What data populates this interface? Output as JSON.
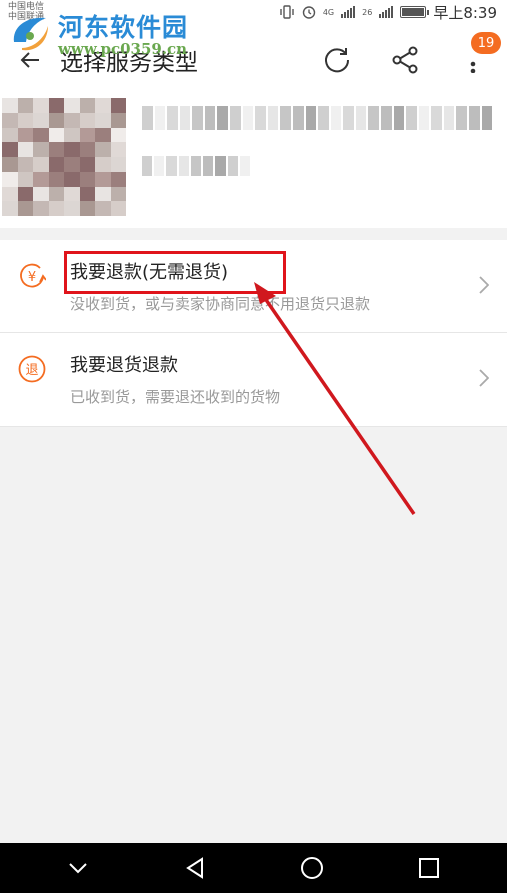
{
  "status_bar": {
    "carrier_line1": "中国电信",
    "carrier_line2": "中国联通",
    "network_label": "4G",
    "signal_label": "26",
    "time": "早上8:39",
    "battery_level": 0.9
  },
  "watermark": {
    "title": "河东软件园",
    "url": "www.pc0359.cn"
  },
  "header": {
    "title": "选择服务类型",
    "badge_count": "19"
  },
  "options": [
    {
      "title": "我要退款(无需退货)",
      "desc": "没收到货，或与卖家协商同意不用退货只退款",
      "icon_glyph": "¥"
    },
    {
      "title": "我要退货退款",
      "desc": "已收到货，需要退还收到的货物",
      "icon_glyph": "退"
    }
  ],
  "colors": {
    "accent": "#f46c21",
    "highlight": "#e0141b",
    "annotation_arrow": "#d0181e"
  }
}
